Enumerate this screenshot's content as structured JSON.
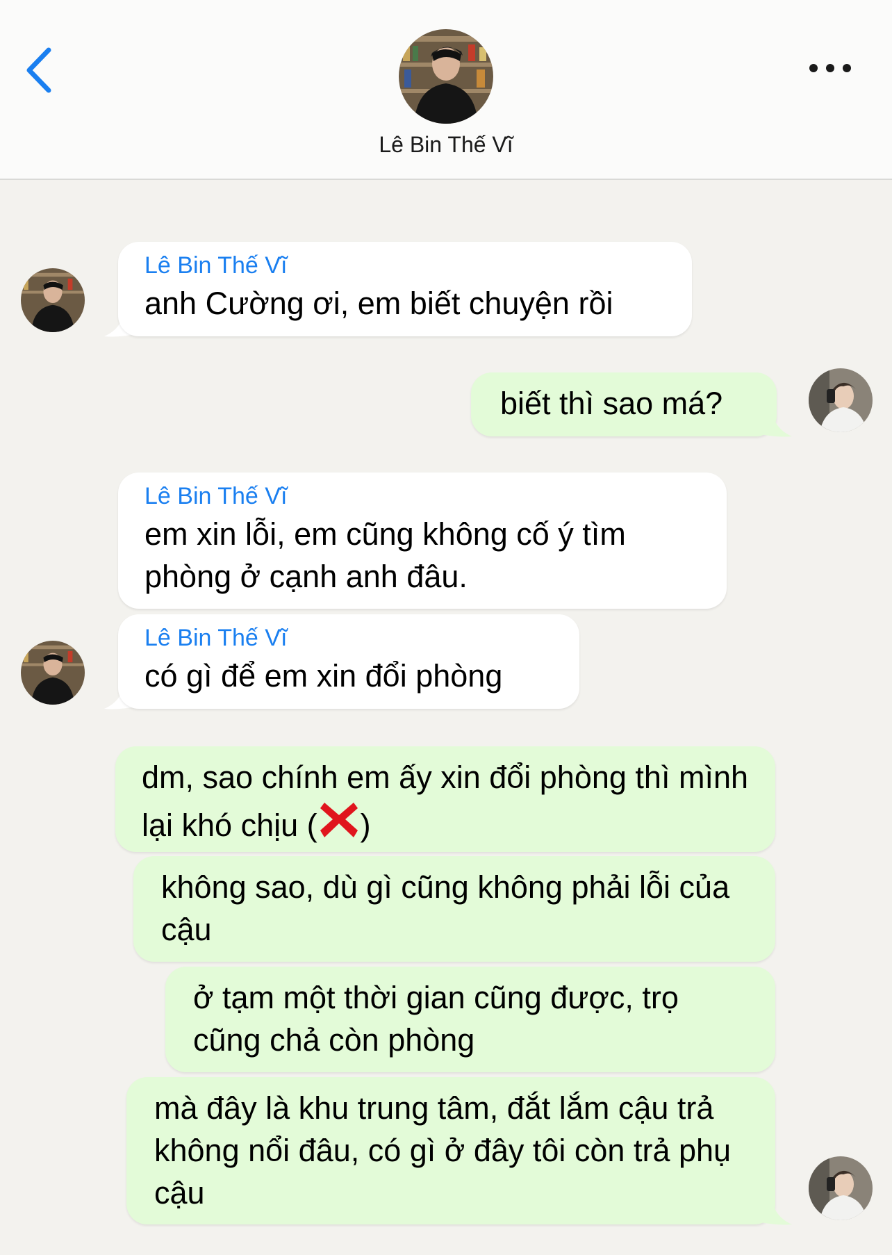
{
  "contact": {
    "name": "Lê Bin Thế Vĩ"
  },
  "header": {
    "back_icon": "chevron-left-icon",
    "more_icon": "ellipsis-icon"
  },
  "colors": {
    "accent": "#1a7ff0",
    "incoming_bubble": "#ffffff",
    "outgoing_bubble": "#e3fbd8",
    "background": "#f3f2ee"
  },
  "messages": [
    {
      "direction": "incoming",
      "sender": "Lê Bin Thế Vĩ",
      "text": "anh Cường ơi, em biết chuyện rồi"
    },
    {
      "direction": "outgoing",
      "text": "biết thì sao má?"
    },
    {
      "direction": "incoming",
      "sender": "Lê Bin Thế Vĩ",
      "text": "em xin lỗi, em cũng không cố ý tìm phòng ở cạnh anh đâu."
    },
    {
      "direction": "incoming",
      "sender": "Lê Bin Thế Vĩ",
      "text": "có gì để em xin đổi phòng"
    },
    {
      "direction": "outgoing",
      "text_before": "dm, sao chính em ấy xin đổi phòng thì mình lại khó chịu (",
      "emoji": "cross-mark-icon",
      "text_after": ")"
    },
    {
      "direction": "outgoing",
      "text": "không sao, dù gì cũng không phải lỗi của cậu"
    },
    {
      "direction": "outgoing",
      "text": "ở tạm một thời gian cũng được, trọ cũng chả còn phòng"
    },
    {
      "direction": "outgoing",
      "text": "mà đây là khu trung tâm, đắt lắm cậu trả không nổi đâu, có gì ở đây tôi còn trả phụ cậu"
    }
  ]
}
